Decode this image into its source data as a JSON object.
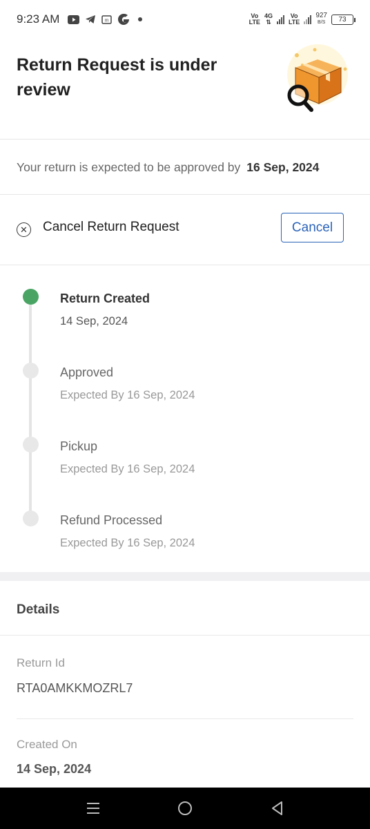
{
  "status_bar": {
    "time": "9:23 AM",
    "left_icons": [
      "youtube-icon",
      "telegram-icon",
      "message-icon",
      "app-g-icon",
      "dot-icon"
    ],
    "net1_top": "Vo",
    "net1_bottom": "LTE",
    "net2_top": "4G",
    "net3_top": "Vo",
    "net3_bottom": "LTE",
    "speed_value": "927",
    "speed_unit": "B/S",
    "battery": "73"
  },
  "header": {
    "title": "Return Request is under review",
    "illustration": "box-search-icon"
  },
  "expected": {
    "text": "Your return is expected to be approved by",
    "date": "16 Sep, 2024"
  },
  "cancel": {
    "label": "Cancel Return Request",
    "button": "Cancel"
  },
  "timeline": {
    "steps": [
      {
        "title": "Return Created",
        "subtitle": "14 Sep, 2024",
        "done": true
      },
      {
        "title": "Approved",
        "subtitle": "Expected By 16 Sep, 2024",
        "done": false
      },
      {
        "title": "Pickup",
        "subtitle": "Expected By 16 Sep, 2024",
        "done": false
      },
      {
        "title": "Refund Processed",
        "subtitle": "Expected By 16 Sep, 2024",
        "done": false
      }
    ]
  },
  "details": {
    "title": "Details",
    "return_id_label": "Return Id",
    "return_id_value": "RTA0AMKKMOZRL7",
    "created_on_label": "Created On",
    "created_on_value": "14 Sep, 2024"
  },
  "nav_bar": {
    "icons": [
      "menu-icon",
      "home-icon",
      "back-icon"
    ]
  },
  "colors": {
    "accent": "#2b63b8",
    "success": "#4aa564",
    "box_orange": "#f0962f"
  }
}
